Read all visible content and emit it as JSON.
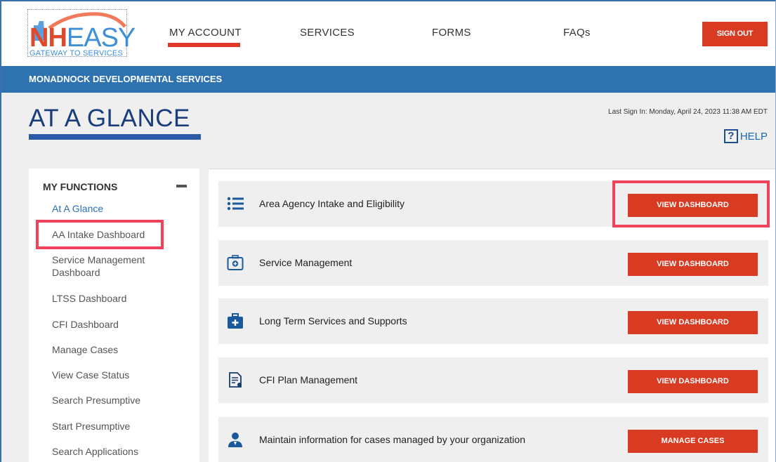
{
  "header": {
    "logo": {
      "brand_nh": "NH",
      "brand_easy": "EASY",
      "tagline": "GATEWAY TO SERVICES"
    },
    "nav": [
      {
        "label": "MY ACCOUNT",
        "active": true
      },
      {
        "label": "SERVICES"
      },
      {
        "label": "FORMS"
      },
      {
        "label": "FAQs"
      }
    ],
    "sign_out": "SIGN OUT"
  },
  "banner": {
    "org_name": "MONADNOCK DEVELOPMENTAL SERVICES"
  },
  "page": {
    "title": "AT A GLANCE",
    "last_sign_in": "Last Sign In: Monday, April 24, 2023 11:38 AM EDT",
    "help_label": "HELP",
    "help_icon_glyph": "?"
  },
  "sidebar": {
    "heading": "MY FUNCTIONS",
    "items": [
      {
        "label": "At A Glance",
        "active": true
      },
      {
        "label": "AA Intake Dashboard"
      },
      {
        "label": "Service Management Dashboard"
      },
      {
        "label": "LTSS Dashboard"
      },
      {
        "label": "CFI Dashboard"
      },
      {
        "label": "Manage Cases"
      },
      {
        "label": "View Case Status"
      },
      {
        "label": "Search Presumptive"
      },
      {
        "label": "Start Presumptive"
      },
      {
        "label": "Search Applications"
      }
    ]
  },
  "functions": [
    {
      "icon": "list-icon",
      "label": "Area Agency Intake and Eligibility",
      "button": "VIEW DASHBOARD"
    },
    {
      "icon": "briefcase-icon",
      "label": "Service Management",
      "button": "VIEW DASHBOARD"
    },
    {
      "icon": "medical-kit-icon",
      "label": "Long Term Services and Supports",
      "button": "VIEW DASHBOARD"
    },
    {
      "icon": "document-edit-icon",
      "label": "CFI Plan Management",
      "button": "VIEW DASHBOARD"
    },
    {
      "icon": "person-icon",
      "label": "Maintain information for cases managed by your organization",
      "button": "MANAGE CASES"
    }
  ],
  "colors": {
    "accent_red": "#d93a22",
    "banner_blue": "#2e73b0",
    "title_navy": "#1a3d7c",
    "highlight_pink": "#f0425a"
  }
}
